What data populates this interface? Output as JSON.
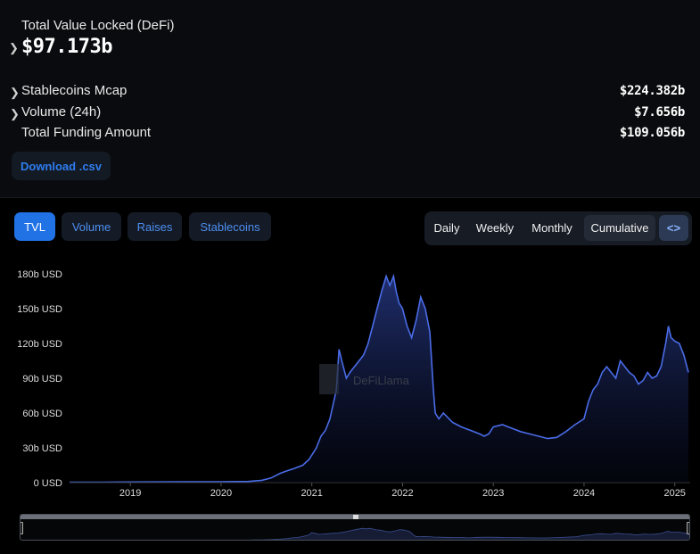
{
  "summary": {
    "tvl_label": "Total Value Locked (DeFi)",
    "tvl_value": "$97.173b",
    "rows": [
      {
        "label": "Stablecoins Mcap",
        "value": "$224.382b"
      },
      {
        "label": "Volume (24h)",
        "value": "$7.656b"
      },
      {
        "label": "Total Funding Amount",
        "value": "$109.056b"
      }
    ],
    "download_label": "Download .csv"
  },
  "tabs": [
    {
      "label": "TVL",
      "active": true
    },
    {
      "label": "Volume",
      "active": false
    },
    {
      "label": "Raises",
      "active": false
    },
    {
      "label": "Stablecoins",
      "active": false
    }
  ],
  "periods": [
    {
      "label": "Daily",
      "active": false
    },
    {
      "label": "Weekly",
      "active": false
    },
    {
      "label": "Monthly",
      "active": false
    },
    {
      "label": "Cumulative",
      "active": true
    }
  ],
  "embed_label": "<>",
  "watermark": "DeFiLlama",
  "colors": {
    "line": "#4a6ce8",
    "accent": "#2172e5",
    "background": "#000000"
  },
  "chart_data": {
    "type": "area",
    "x_unit": "year",
    "y_unit": "USD (billions)",
    "ylim": [
      0,
      180
    ],
    "yticks": [
      "0 USD",
      "30b USD",
      "60b USD",
      "90b USD",
      "120b USD",
      "150b USD",
      "180b USD"
    ],
    "xticks": [
      "2019",
      "2020",
      "2021",
      "2022",
      "2023",
      "2024",
      "2025"
    ],
    "x": [
      2018.33,
      2018.7,
      2019.0,
      2019.3,
      2019.6,
      2020.0,
      2020.3,
      2020.45,
      2020.55,
      2020.65,
      2020.72,
      2020.8,
      2020.9,
      2020.97,
      2021.05,
      2021.1,
      2021.15,
      2021.2,
      2021.27,
      2021.3,
      2021.33,
      2021.38,
      2021.42,
      2021.47,
      2021.52,
      2021.57,
      2021.62,
      2021.67,
      2021.72,
      2021.77,
      2021.82,
      2021.86,
      2021.9,
      2021.93,
      2021.96,
      2022.0,
      2022.05,
      2022.1,
      2022.15,
      2022.2,
      2022.25,
      2022.3,
      2022.34,
      2022.36,
      2022.4,
      2022.45,
      2022.55,
      2022.65,
      2022.75,
      2022.85,
      2022.9,
      2022.95,
      2023.0,
      2023.1,
      2023.2,
      2023.3,
      2023.4,
      2023.5,
      2023.6,
      2023.7,
      2023.8,
      2023.9,
      2024.0,
      2024.05,
      2024.1,
      2024.15,
      2024.2,
      2024.25,
      2024.3,
      2024.35,
      2024.4,
      2024.45,
      2024.5,
      2024.55,
      2024.6,
      2024.65,
      2024.7,
      2024.75,
      2024.8,
      2024.85,
      2024.9,
      2024.93,
      2024.96,
      2025.0,
      2025.05,
      2025.1,
      2025.15
    ],
    "values": [
      0.3,
      0.4,
      0.5,
      0.6,
      0.7,
      0.8,
      1.0,
      2.0,
      4.0,
      8.0,
      10.0,
      12.0,
      15.0,
      20.0,
      30.0,
      40.0,
      45.0,
      55.0,
      80.0,
      115.0,
      105.0,
      90.0,
      95.0,
      100.0,
      105.0,
      110.0,
      120.0,
      135.0,
      150.0,
      165.0,
      178.0,
      170.0,
      178.0,
      165.0,
      155.0,
      150.0,
      135.0,
      125.0,
      140.0,
      160.0,
      150.0,
      130.0,
      80.0,
      60.0,
      55.0,
      60.0,
      52.0,
      48.0,
      45.0,
      42.0,
      40.0,
      42.0,
      48.0,
      50.0,
      47.0,
      44.0,
      42.0,
      40.0,
      38.0,
      39.0,
      44.0,
      50.0,
      55.0,
      70.0,
      80.0,
      85.0,
      95.0,
      100.0,
      95.0,
      90.0,
      105.0,
      100.0,
      95.0,
      92.0,
      85.0,
      88.0,
      95.0,
      90.0,
      92.0,
      100.0,
      120.0,
      135.0,
      125.0,
      122.0,
      120.0,
      110.0,
      95.0
    ]
  }
}
